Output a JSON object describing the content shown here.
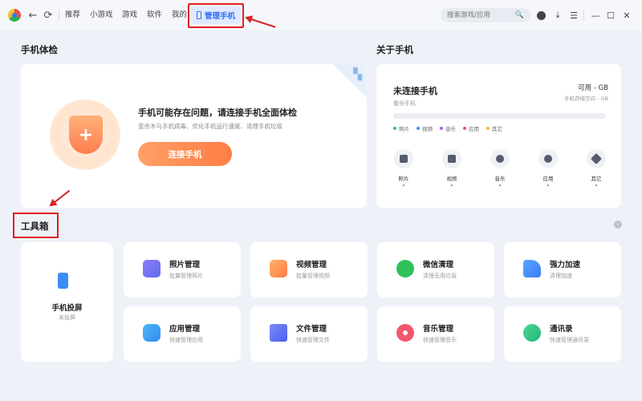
{
  "topbar": {
    "back_label": "←",
    "refresh_label": "⟳",
    "tabs": [
      "推荐",
      "小游戏",
      "游戏",
      "软件",
      "我的"
    ],
    "active_tab": "管理手机",
    "search_placeholder": "搜索游戏/应用",
    "search_icon": "🔍",
    "download_label": "⤓",
    "menu_label": "☰",
    "min_label": "—",
    "max_label": "☐",
    "close_label": "✕"
  },
  "check": {
    "section_title": "手机体检",
    "qr_glyph": "▚",
    "shield_glyph": "+",
    "title": "手机可能存在问题，请连接手机全面体检",
    "subtitle": "查杀木马手机病毒、优化手机运行速度、清理手机垃圾",
    "button": "连接手机"
  },
  "about": {
    "section_title": "关于手机",
    "title": "未连接手机",
    "subtitle": "备份手机",
    "available": "可用 - GB",
    "storage": "手机存储空间 - GB",
    "legend": [
      "照片",
      "视频",
      "音乐",
      "应用",
      "其它"
    ],
    "legend_colors": [
      "#2bc48a",
      "#4a8cf7",
      "#b45ef2",
      "#f2576a",
      "#f5b833"
    ],
    "stats": [
      {
        "label": "照片",
        "value": "-",
        "icon": "photo-icon"
      },
      {
        "label": "视频",
        "value": "-",
        "icon": "video-icon"
      },
      {
        "label": "音乐",
        "value": "-",
        "icon": "music-icon"
      },
      {
        "label": "应用",
        "value": "-",
        "icon": "app-icon"
      },
      {
        "label": "其它",
        "value": "-",
        "icon": "layers-icon"
      }
    ]
  },
  "toolbox": {
    "section_title": "工具箱",
    "scroll_glyph": "›",
    "cast": {
      "title": "手机投屏",
      "subtitle": "未投屏"
    },
    "tools": [
      {
        "title": "照片管理",
        "subtitle": "批量管理照片",
        "color": "#7b6cf0"
      },
      {
        "title": "视频管理",
        "subtitle": "批量管理视频",
        "color": "#ff8a4c"
      },
      {
        "title": "微信清理",
        "subtitle": "清理无用垃圾",
        "color": "#2fc25b"
      },
      {
        "title": "强力加速",
        "subtitle": "清理加速",
        "color": "#3b8cf5"
      },
      {
        "title": "应用管理",
        "subtitle": "快速管理应用",
        "color": "#2f9bf2"
      },
      {
        "title": "文件管理",
        "subtitle": "快速管理文件",
        "color": "#5c6cf3"
      },
      {
        "title": "音乐管理",
        "subtitle": "快速管理音乐",
        "color": "#f2576a"
      },
      {
        "title": "通讯录",
        "subtitle": "快速管理通讯录",
        "color": "#28c07f"
      }
    ]
  }
}
